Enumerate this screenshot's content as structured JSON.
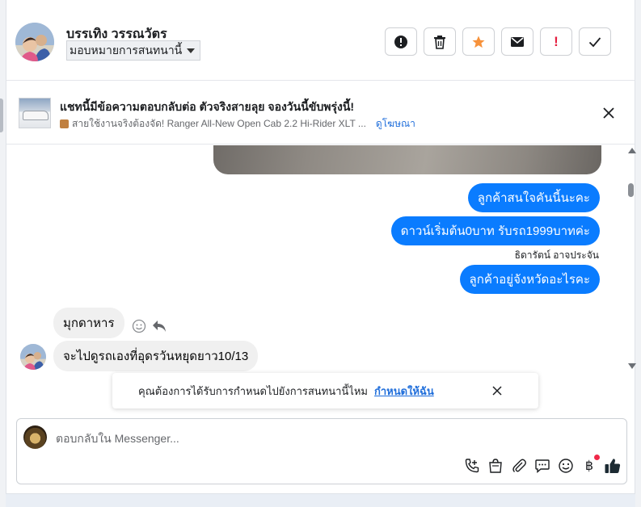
{
  "header": {
    "contact_name": "บรรเทิง วรรณวัตร",
    "assign_label": "มอบหมายการสนทนานี้",
    "actions": [
      {
        "name": "mark-spam-button",
        "icon": "exclamation-circle-icon"
      },
      {
        "name": "delete-button",
        "icon": "trash-icon"
      },
      {
        "name": "star-button",
        "icon": "star-icon"
      },
      {
        "name": "mark-unread-button",
        "icon": "envelope-icon"
      },
      {
        "name": "follow-up-button",
        "icon": "exclamation-icon",
        "text": "!"
      },
      {
        "name": "mark-done-button",
        "icon": "check-icon"
      }
    ]
  },
  "ad": {
    "title": "แชทนี้มีข้อความตอบกลับต่อ ตัวจริงสายลุย จองวันนี้ขับพรุ่งนี้!",
    "subtitle": "สายใช้งานจริงต้องจัด! Ranger All-New Open Cab 2.2 Hi-Rider XLT ...",
    "see_ad": "ดูโฆษณา"
  },
  "messages": {
    "out_1": "ลูกค้าสนใจคันนี้นะคะ",
    "out_2": "ดาวน์เริ่มต้น0บาท รับรถ1999บาทค่ะ",
    "sender": "ธิดารัตน์ อาจประจัน",
    "out_3": "ลูกค้าอยู่จังหวัดอะไรคะ",
    "in_1": "มุกดาหาร",
    "in_2": "จะไปดูรถเองที่อุดรวันหยุดยาว10/13"
  },
  "toast": {
    "text": "คุณต้องการได้รับการกำหนดไปยังการสนทนานี้ไหม",
    "link": "กำหนดให้ฉัน"
  },
  "composer": {
    "placeholder": "ตอบกลับใน Messenger...",
    "currency_symbol": "฿"
  },
  "colors": {
    "accent_blue": "#0a7cff",
    "link_blue": "#216fdb",
    "star_orange": "#f7923b",
    "alert_red": "#e41e3f",
    "like_dark": "#1c2b33"
  }
}
